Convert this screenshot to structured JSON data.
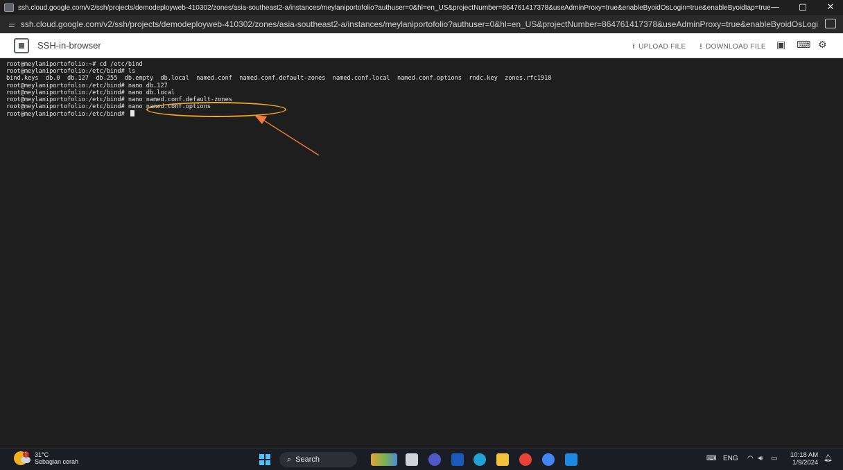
{
  "window": {
    "title": "ssh.cloud.google.com/v2/ssh/projects/demodeployweb-410302/zones/asia-southeast2-a/instances/meylaniportofolio?authuser=0&hl=en_US&projectNumber=864761417378&useAdminProxy=true&enableByoidOsLogin=true&enableByoidIap=true - Googl...",
    "minimize": "—",
    "maximize": "▢",
    "close": "✕"
  },
  "address_bar": {
    "url": "ssh.cloud.google.com/v2/ssh/projects/demodeployweb-410302/zones/asia-southeast2-a/instances/meylaniportofolio?authuser=0&hl=en_US&projectNumber=864761417378&useAdminProxy=true&enableByoidOsLogin=true&enabl..."
  },
  "toolbar": {
    "app_title": "SSH-in-browser",
    "upload_label": "UPLOAD FILE",
    "download_label": "DOWNLOAD FILE",
    "upload_icon": "upload-icon",
    "download_icon": "download-icon"
  },
  "terminal": {
    "lines": [
      "root@meylaniportofolio:~# cd /etc/bind",
      "root@meylaniportofolio:/etc/bind# ls",
      "bind.keys  db.0  db.127  db.255  db.empty  db.local  named.conf  named.conf.default-zones  named.conf.local  named.conf.options  rndc.key  zones.rfc1918",
      "root@meylaniportofolio:/etc/bind# nano db.127",
      "root@meylaniportofolio:/etc/bind# nano db.local",
      "root@meylaniportofolio:/etc/bind# nano named.conf.default-zones",
      "root@meylaniportofolio:/etc/bind# nano named.conf.options",
      "root@meylaniportofolio:/etc/bind# "
    ]
  },
  "taskbar": {
    "weather_temp": "31°C",
    "weather_desc": "Sebagian cerah",
    "weather_badge": "1",
    "search_placeholder": "Search",
    "language": "ENG",
    "time": "10:18 AM",
    "date": "1/9/2024"
  },
  "colors": {
    "terminal_bg": "#1e1e1e",
    "annotation": "#f5a623",
    "arrow": "#f07b3f"
  }
}
